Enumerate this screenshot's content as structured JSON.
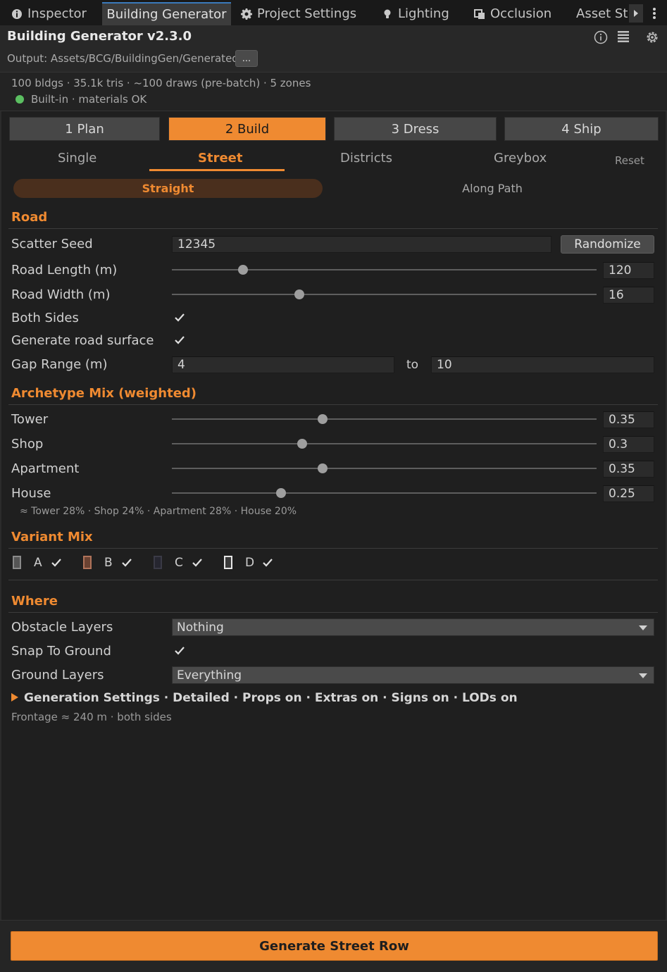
{
  "editor_tabs": [
    {
      "label": "Inspector",
      "icon": "info-icon"
    },
    {
      "label": "Building Generator",
      "icon": ""
    },
    {
      "label": "Project Settings",
      "icon": "gear-icon"
    },
    {
      "label": "Lighting",
      "icon": "bulb-icon"
    },
    {
      "label": "Occlusion",
      "icon": "occlusion-icon"
    },
    {
      "label": "Asset St",
      "icon": ""
    }
  ],
  "header": {
    "title": "Building Generator v2.3.0",
    "output_path": "Output: Assets/BCG/BuildingGen/Generated",
    "browse_label": "..."
  },
  "stats": {
    "summary": "100 bldgs · 35.1k tris · ~100 draws (pre-batch) · 5 zones",
    "status": "Built-in · materials OK",
    "status_color": "#5bbf61"
  },
  "steps": [
    "1 Plan",
    "2 Build",
    "3 Dress",
    "4 Ship"
  ],
  "subtabs": [
    "Single",
    "Street",
    "Districts",
    "Greybox"
  ],
  "reset_label": "Reset",
  "modes": [
    "Straight",
    "Along Path"
  ],
  "road": {
    "heading": "Road",
    "scatter_seed_label": "Scatter Seed",
    "scatter_seed": "12345",
    "randomize_label": "Randomize",
    "road_length_label": "Road Length (m)",
    "road_length": "120",
    "road_length_fraction": 0.167,
    "road_width_label": "Road Width (m)",
    "road_width": "16",
    "road_width_fraction": 0.3,
    "both_sides_label": "Both Sides",
    "both_sides": true,
    "surface_label": "Generate road surface",
    "surface": true,
    "gap_label": "Gap Range (m)",
    "gap_min": "4",
    "gap_to": "to",
    "gap_max": "10"
  },
  "archetype": {
    "heading": "Archetype Mix (weighted)",
    "items": [
      {
        "label": "Tower",
        "value": "0.35",
        "fraction": 0.355
      },
      {
        "label": "Shop",
        "value": "0.3",
        "fraction": 0.306
      },
      {
        "label": "Apartment",
        "value": "0.35",
        "fraction": 0.355
      },
      {
        "label": "House",
        "value": "0.25",
        "fraction": 0.257
      }
    ],
    "note": "≈ Tower 28% · Shop 24% · Apartment 28% · House 20%"
  },
  "variant": {
    "heading": "Variant Mix",
    "items": [
      {
        "label": "A",
        "color": "#8a8a8a",
        "checked": true
      },
      {
        "label": "B",
        "color": "#b0735a",
        "checked": true
      },
      {
        "label": "C",
        "color": "#3a3a46",
        "checked": true
      },
      {
        "label": "D",
        "color": "#e6e6e6",
        "checked": true
      }
    ]
  },
  "where": {
    "heading": "Where",
    "obstacle_label": "Obstacle Layers",
    "obstacle_value": "Nothing",
    "snap_label": "Snap To Ground",
    "snap": true,
    "ground_label": "Ground Layers",
    "ground_value": "Everything"
  },
  "generation_summary": "Generation Settings · Detailed · Props on · Extras on · Signs on · LODs on",
  "frontage": "Frontage ≈ 240 m · both sides",
  "generate_label": "Generate Street Row",
  "accent_color": "#ef8a31"
}
